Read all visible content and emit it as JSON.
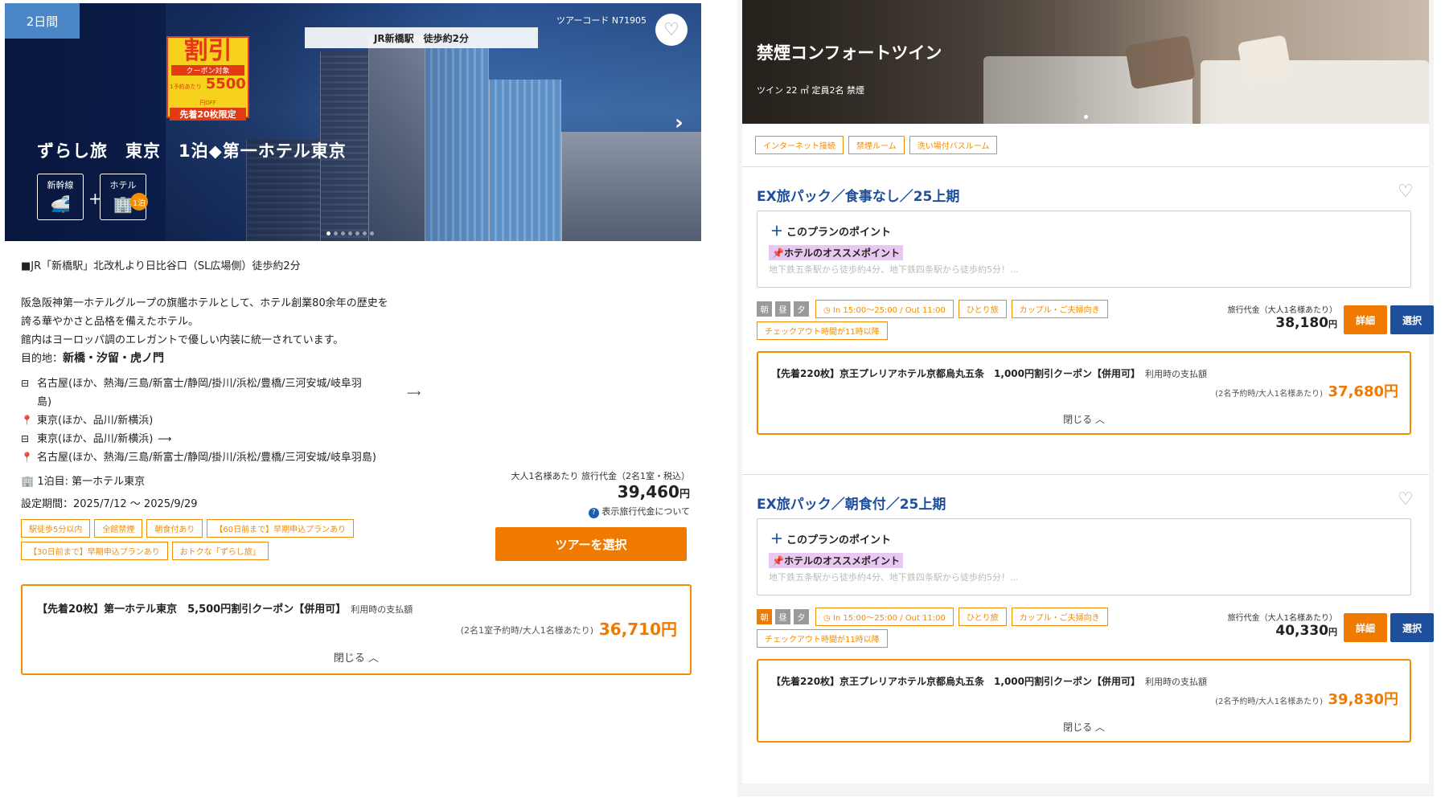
{
  "tour": {
    "days_badge": "2日間",
    "tour_code": "ツアーコード N71905",
    "station_tag": "JR新橋駅　徒歩約2分",
    "coupon_sticker": {
      "big": "割引",
      "sub": "クーポン対象",
      "per": "1予約あたり",
      "amount": "5500",
      "unit": "円OFF",
      "limit": "先着20枚限定"
    },
    "title": "ずらし旅　東京　1泊◆第一ホテル東京",
    "transport": [
      {
        "label": "新幹線",
        "icon": "train-icon"
      },
      {
        "label": "ホテル",
        "icon": "hotel-icon",
        "badge": "1泊"
      }
    ],
    "description": {
      "access": "■JR「新橋駅」北改札より日比谷口（SL広場側）徒歩約2分",
      "lines": [
        "阪急阪神第一ホテルグループの旗艦ホテルとして、ホテル創業80余年の歴史を",
        "誇る華やかさと品格を備えたホテル。",
        "館内はヨーロッパ調のエレガントで優しい内装に統一されています。"
      ],
      "destination_label": "目的地：",
      "destination": "新橋・汐留・虎ノ門"
    },
    "route": [
      {
        "icon": "seat-icon",
        "text": "名古屋(ほか、熱海/三島/新富士/静岡/掛川/浜松/豊橋/三河安城/岐阜羽",
        "text2": "島)",
        "arrow": "⟶"
      },
      {
        "icon": "pin-icon",
        "text": "東京(ほか、品川/新横浜)"
      },
      {
        "icon": "seat-icon",
        "text": "東京(ほか、品川/新横浜)",
        "arrow": "⟶"
      },
      {
        "icon": "pin-icon",
        "text": "名古屋(ほか、熱海/三島/新富士/静岡/掛川/浜松/豊橋/三河安城/岐阜羽島)"
      }
    ],
    "stay": "1泊目: 第一ホテル東京",
    "period": "設定期間：2025/7/12 〜 2025/9/29",
    "tags": [
      "駅徒歩5分以内",
      "全館禁煙",
      "朝食付あり",
      "【60日前まで】早期申込プランあり",
      "【30日前まで】早期申込プランあり",
      "おトクな「ずらし旅」"
    ],
    "price": {
      "label": "大人1名様あたり 旅行代金（2名1室・税込）",
      "value": "39,460",
      "yen": "円",
      "about": "表示旅行代金について"
    },
    "select_button": "ツアーを選択",
    "coupon": {
      "title": "【先着20枚】第一ホテル東京　5,500円割引クーポン【併用可】",
      "sub": "利用時の支払額",
      "note": "(2名1室予約時/大人1名様あたり)",
      "amount": "36,710円",
      "close": "閉じる ︿"
    }
  },
  "room": {
    "title": "禁煙コンフォートツイン",
    "meta": "ツイン 22 ㎡ 定員2名 禁煙",
    "amenities": [
      "インターネット接続",
      "禁煙ルーム",
      "洗い場付バスルーム"
    ],
    "plans": [
      {
        "name": "EX旅パック／食事なし／25上期",
        "points_header": "このプランのポイント",
        "points_highlight": "📌ホテルのオススメポイント",
        "points_fade": "地下鉄五条駅から徒歩約4分、地下鉄四条駅から徒歩約5分！...",
        "meals": [
          {
            "label": "朝",
            "on": false
          },
          {
            "label": "昼",
            "on": false
          },
          {
            "label": "夕",
            "on": false
          }
        ],
        "tags": [
          "◷ In 15:00〜25:00 / Out 11:00",
          "ひとり旅",
          "カップル・ご夫婦向き"
        ],
        "tag2": "チェックアウト時間が11時以降",
        "price_label": "旅行代金（大人1名様あたり）",
        "price": "38,180",
        "yen": "円",
        "detail": "詳細",
        "select": "選択",
        "coupon": {
          "title": "【先着220枚】京王プレリアホテル京都烏丸五条　1,000円割引クーポン【併用可】",
          "sub": "利用時の支払額",
          "note": "(2名予約時/大人1名様あたり)",
          "amount": "37,680円",
          "close": "閉じる ︿"
        }
      },
      {
        "name": "EX旅パック／朝食付／25上期",
        "points_header": "このプランのポイント",
        "points_highlight": "📌ホテルのオススメポイント",
        "points_fade": "地下鉄五条駅から徒歩約4分、地下鉄四条駅から徒歩約5分！...",
        "meals": [
          {
            "label": "朝",
            "on": true
          },
          {
            "label": "昼",
            "on": false
          },
          {
            "label": "夕",
            "on": false
          }
        ],
        "tags": [
          "◷ In 15:00〜25:00 / Out 11:00",
          "ひとり旅",
          "カップル・ご夫婦向き"
        ],
        "tag2": "チェックアウト時間が11時以降",
        "price_label": "旅行代金（大人1名様あたり）",
        "price": "40,330",
        "yen": "円",
        "detail": "詳細",
        "select": "選択",
        "coupon": {
          "title": "【先着220枚】京王プレリアホテル京都烏丸五条　1,000円割引クーポン【併用可】",
          "sub": "利用時の支払額",
          "note": "(2名予約時/大人1名様あたり)",
          "amount": "39,830円",
          "close": "閉じる ︿"
        }
      }
    ]
  },
  "colors": {
    "accent": "#f07a00",
    "brand": "#1d4f9c",
    "tag_border": "#f28c00"
  }
}
